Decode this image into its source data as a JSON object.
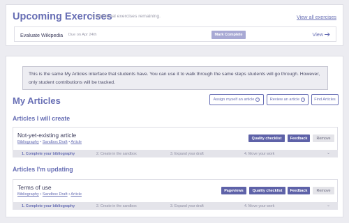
{
  "upcoming": {
    "title": "Upcoming Exercises",
    "remaining": "4 additional exercises remaining.",
    "view_all": "View all exercises",
    "exercise": {
      "name": "Evaluate Wikipedia",
      "due": "Due on Apr 24th",
      "mark_complete": "Mark Complete",
      "view": "View"
    }
  },
  "notice": "This is the same My Articles interface that students have. You can use it to walk through the same steps students will go through. However, only student contributions will be tracked.",
  "my_articles": {
    "title": "My Articles",
    "assign_myself": "Assign myself an article",
    "review": "Review an article",
    "find": "Find Articles"
  },
  "create_section": {
    "title": "Articles I will create",
    "card": {
      "title": "Not-yet-existing article",
      "links": [
        "Bibliography",
        "Sandbox Draft",
        "Article"
      ],
      "buttons": {
        "quality": "Quality checklist",
        "feedback": "Feedback",
        "remove": "Remove"
      },
      "steps": [
        "1. Complete your bibliography",
        "2. Create in the sandbox",
        "3. Expand your draft",
        "4. Move your work"
      ]
    }
  },
  "update_section": {
    "title": "Articles I'm updating",
    "card": {
      "title": "Terms of use",
      "links": [
        "Bibliography",
        "Sandbox Draft",
        "Article"
      ],
      "buttons": {
        "pageviews": "Pageviews",
        "quality": "Quality checklist",
        "feedback": "Feedback",
        "remove": "Remove"
      },
      "steps": [
        "1. Complete your bibliography",
        "2. Create in the sandbox",
        "3. Expand your draft",
        "4. Move your work"
      ]
    }
  },
  "icons": {
    "view_arrow": "arrow-right-icon",
    "help": "question-circle-icon",
    "expand": "chevron-down-icon"
  },
  "colors": {
    "accent": "#676eb4",
    "button": "#5e62a8",
    "mark_complete": "#a8a9d4",
    "background": "#ececf1"
  }
}
